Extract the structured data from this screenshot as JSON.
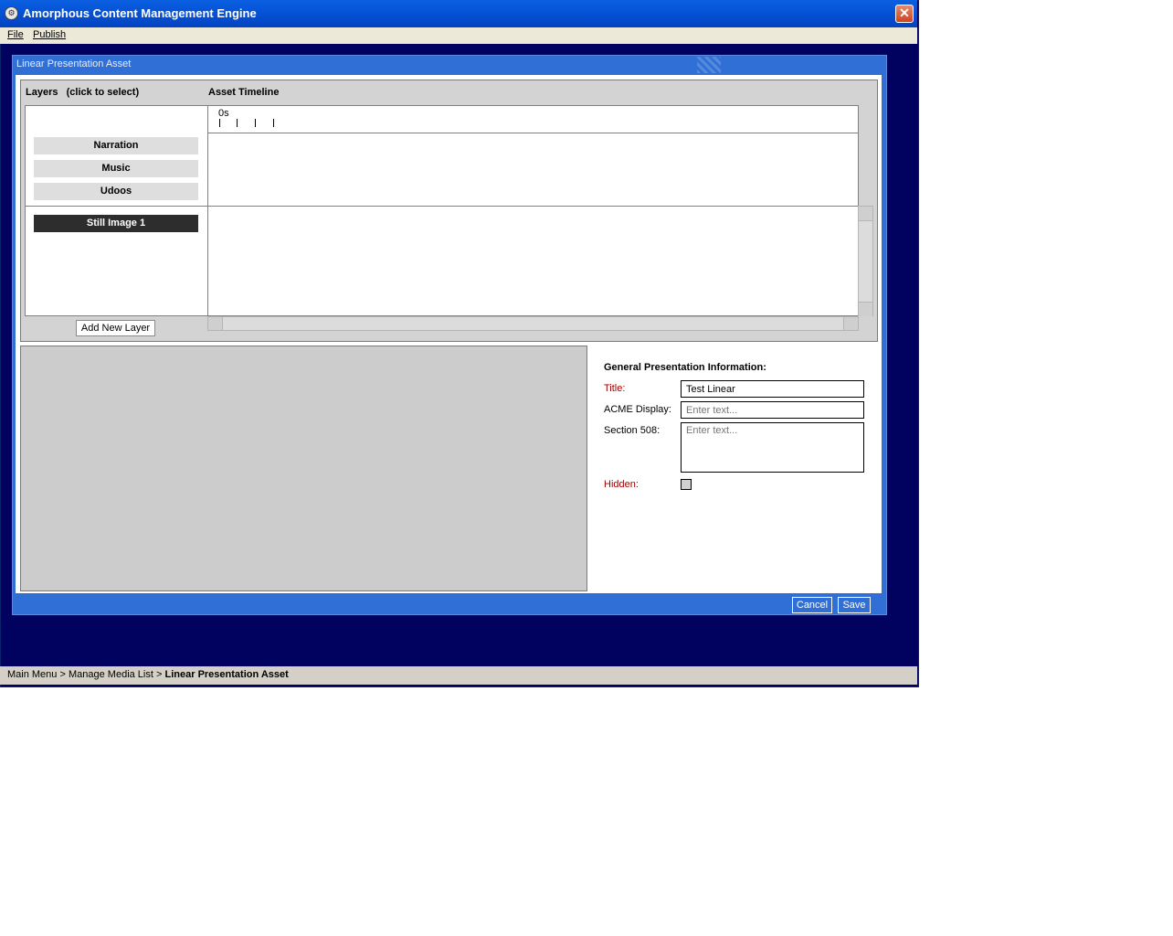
{
  "window": {
    "title": "Amorphous Content Management Engine",
    "close_glyph": "✕"
  },
  "menu": {
    "file": "File",
    "publish": "Publish"
  },
  "dialog": {
    "title": "Linear Presentation Asset",
    "cancel_label": "Cancel",
    "save_label": "Save"
  },
  "layers": {
    "header": "Layers   (click to select)",
    "items": [
      {
        "label": "Narration",
        "selected": false
      },
      {
        "label": "Music",
        "selected": false
      },
      {
        "label": "Udoos",
        "selected": false
      },
      {
        "label": "Still Image 1",
        "selected": true
      }
    ],
    "add_button": "Add New Layer"
  },
  "timeline": {
    "header": "Asset Timeline",
    "zero_label": "0s"
  },
  "info": {
    "heading": "General Presentation Information:",
    "title_label": "Title:",
    "title_value": "Test Linear",
    "acme_label": "ACME Display:",
    "acme_placeholder": "Enter text...",
    "section508_label": "Section 508:",
    "section508_placeholder": "Enter text...",
    "hidden_label": "Hidden:",
    "hidden_checked": false
  },
  "statusbar": {
    "crumb_main": "Main Menu",
    "crumb_sep": ">",
    "crumb_media": "Manage Media List",
    "crumb_current": "Linear Presentation Asset"
  },
  "colors": {
    "window_bg": "#01015f",
    "titlebar": "#0552d6",
    "dialog": "#2f6fd6",
    "required_label": "#a00000",
    "selected_layer": "#2d2d2d"
  }
}
